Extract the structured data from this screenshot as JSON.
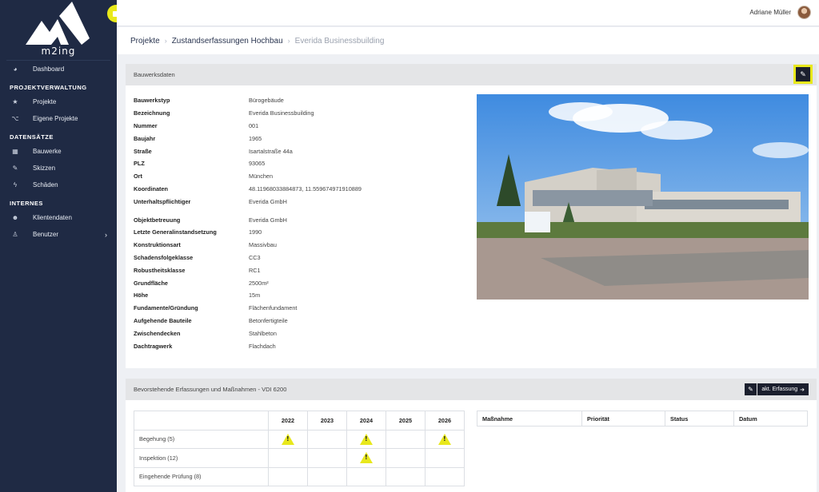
{
  "brand": {
    "name": "m2ing",
    "accent": "#e8e81c",
    "sidebar_bg": "#1f2a44"
  },
  "sidebar": {
    "items": [
      {
        "type": "item",
        "label": "Dashboard",
        "icon": "dashboard-icon"
      },
      {
        "type": "section",
        "label": "PROJEKTVERWALTUNG"
      },
      {
        "type": "item",
        "label": "Projekte",
        "icon": "star-icon"
      },
      {
        "type": "item",
        "label": "Eigene Projekte",
        "icon": "branch-icon"
      },
      {
        "type": "section",
        "label": "DATENSÄTZE"
      },
      {
        "type": "item",
        "label": "Bauwerke",
        "icon": "building-icon"
      },
      {
        "type": "item",
        "label": "Skizzen",
        "icon": "edit-icon"
      },
      {
        "type": "item",
        "label": "Schäden",
        "icon": "bolt-icon"
      },
      {
        "type": "section",
        "label": "INTERNES"
      },
      {
        "type": "item",
        "label": "Klientendaten",
        "icon": "users-icon"
      },
      {
        "type": "item",
        "label": "Benutzer",
        "icon": "user-icon",
        "chevron": true
      }
    ]
  },
  "header": {
    "user_name": "Adriane Müller"
  },
  "breadcrumb": {
    "items": [
      "Projekte",
      "Zustandserfassungen Hochbau"
    ],
    "current": "Everida Businessbuilding"
  },
  "building_card": {
    "title": "Bauwerksdaten",
    "group1": [
      {
        "k": "Bauwerkstyp",
        "v": "Bürogebäude"
      },
      {
        "k": "Bezeichnung",
        "v": "Everida Businessbuilding"
      },
      {
        "k": "Nummer",
        "v": "001"
      },
      {
        "k": "Baujahr",
        "v": "1965"
      },
      {
        "k": "Straße",
        "v": "Isartalstraße 44a"
      },
      {
        "k": "PLZ",
        "v": "93065"
      },
      {
        "k": "Ort",
        "v": "München"
      },
      {
        "k": "Koordinaten",
        "v": "48.11968033884873, 11.559674971910889"
      },
      {
        "k": "Unterhaltspflichtiger",
        "v": "Everida GmbH"
      }
    ],
    "group2": [
      {
        "k": "Objektbetreuung",
        "v": "Everida GmbH"
      },
      {
        "k": "Letzte Generalinstandsetzung",
        "v": "1990"
      },
      {
        "k": "Konstruktionsart",
        "v": "Massivbau"
      },
      {
        "k": "Schadensfolgeklasse",
        "v": "CC3"
      },
      {
        "k": "Robustheitsklasse",
        "v": "RC1"
      },
      {
        "k": "Grundfläche",
        "v": "2500m²"
      },
      {
        "k": "Höhe",
        "v": "15m"
      },
      {
        "k": "Fundamente/Gründung",
        "v": "Flächenfundament"
      },
      {
        "k": "Aufgehende Bauteile",
        "v": "Betonfertigteile"
      },
      {
        "k": "Zwischendecken",
        "v": "Stahlbeton"
      },
      {
        "k": "Dachtragwerk",
        "v": "Flachdach"
      }
    ]
  },
  "schedule_card": {
    "title": "Bevorstehende Erfassungen und Maßnahmen - VDI 6200",
    "button_label": "akt. Erfassung",
    "years": [
      "2022",
      "2023",
      "2024",
      "2025",
      "2026"
    ],
    "rows": [
      {
        "label": "Begehung (5)",
        "warn": [
          true,
          false,
          true,
          false,
          true
        ]
      },
      {
        "label": "Inspektion (12)",
        "warn": [
          false,
          false,
          true,
          false,
          false
        ]
      },
      {
        "label": "Eingehende Prüfung (8)",
        "warn": [
          false,
          false,
          false,
          false,
          false
        ]
      }
    ],
    "measures_headers": [
      "Maßnahme",
      "Priorität",
      "Status",
      "Datum"
    ]
  }
}
